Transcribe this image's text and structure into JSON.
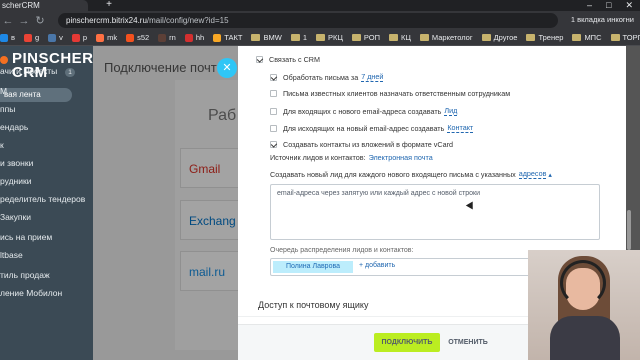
{
  "browser": {
    "tab_title": "scherCRM",
    "new_tab": "+",
    "window_controls": [
      "–",
      "□",
      "✕"
    ],
    "url_host": "pinschercrm.bitrix24.ru",
    "url_path": "/mail/config/new?id=15",
    "incognito_label": "1 вкладка инкогни",
    "bookmarks": [
      {
        "label": "в",
        "color": "#1e88e5"
      },
      {
        "label": "g",
        "color": "#ea4335"
      },
      {
        "label": "v",
        "color": "#4a76a8"
      },
      {
        "label": "p",
        "color": "#e53935"
      },
      {
        "label": "mk",
        "color": "#ff7043"
      },
      {
        "label": "s52",
        "color": "#f4511e"
      },
      {
        "label": "rn",
        "color": "#5d4037"
      },
      {
        "label": "hh",
        "color": "#d32f2f"
      },
      {
        "label": "ТАКТ",
        "color": "#f9a825"
      },
      {
        "label": "BMW",
        "folder": true
      },
      {
        "label": "1",
        "folder": true
      },
      {
        "label": "РКЦ",
        "folder": true
      },
      {
        "label": "РОП",
        "folder": true
      },
      {
        "label": "КЦ",
        "folder": true
      },
      {
        "label": "Маркетолог",
        "folder": true
      },
      {
        "label": "Другое",
        "folder": true
      },
      {
        "label": "Тренер",
        "folder": true
      },
      {
        "label": "МПС",
        "folder": true
      },
      {
        "label": "ТОРГ МАРКЕ",
        "folder": true
      }
    ]
  },
  "sidebar": {
    "logo_line1": "PINSCHER",
    "logo_line2": "CRM",
    "live_feed": "вая лента",
    "items": [
      {
        "label": "ачи и Проекты",
        "count": "1"
      },
      {
        "label": "M"
      },
      {
        "label": "ппы"
      },
      {
        "label": "ендарь"
      },
      {
        "label": "к"
      },
      {
        "label": "и звонки"
      },
      {
        "label": "рудники"
      },
      {
        "label": "ределитель тендеров"
      },
      {
        "label": "Закупки"
      },
      {
        "label": "ись на прием"
      },
      {
        "label": "ltbase"
      },
      {
        "label": "тиль продаж"
      },
      {
        "label": "ление Мобилон"
      }
    ]
  },
  "background": {
    "title": "Подключение почт",
    "panel_word": "Раб",
    "services": [
      "Gmail",
      "Exchang",
      "mail.ru"
    ]
  },
  "panel": {
    "crm_link_label": "Связать с CRM",
    "options": [
      {
        "checked": true,
        "text": "Обработать письма за",
        "link": "7 дней",
        "style": "dash"
      },
      {
        "checked": false,
        "text": "Письма известных клиентов назначать ответственным сотрудникам"
      },
      {
        "checked": false,
        "text": "Для входящих с нового email-адреса создавать",
        "link": "Лид",
        "style": "dash"
      },
      {
        "checked": false,
        "text": "Для исходящих на новый email-адрес создавать",
        "link": "Контакт",
        "style": "dash"
      },
      {
        "checked": true,
        "text": "Создавать контакты из вложений в формате vCard"
      }
    ],
    "source_label": "Источник лидов и контактов:",
    "source_value": "Электронная почта",
    "create_new_label": "Создавать новый лид для каждого нового входящего письма с указанных",
    "create_new_link": "адресов",
    "create_new_arrow": "▴",
    "textarea_placeholder": "email-адреса через запятую или каждый адрес с новой строки",
    "queue_label": "Очередь распределения лидов и контактов:",
    "queue_user": "Полина Лаврова",
    "queue_add": "+ добавить",
    "mailbox_title": "Доступ к почтовому ящику",
    "connect_button": "ПОДКЛЮЧИТЬ",
    "cancel_button": "ОТМЕНИТЬ",
    "close_icon": "✕"
  },
  "colors": {
    "sidebar_bg": "#3b4a55",
    "accent_blue": "#2fc6f6",
    "connect_green": "#bbed21",
    "link": "#2067b0"
  }
}
